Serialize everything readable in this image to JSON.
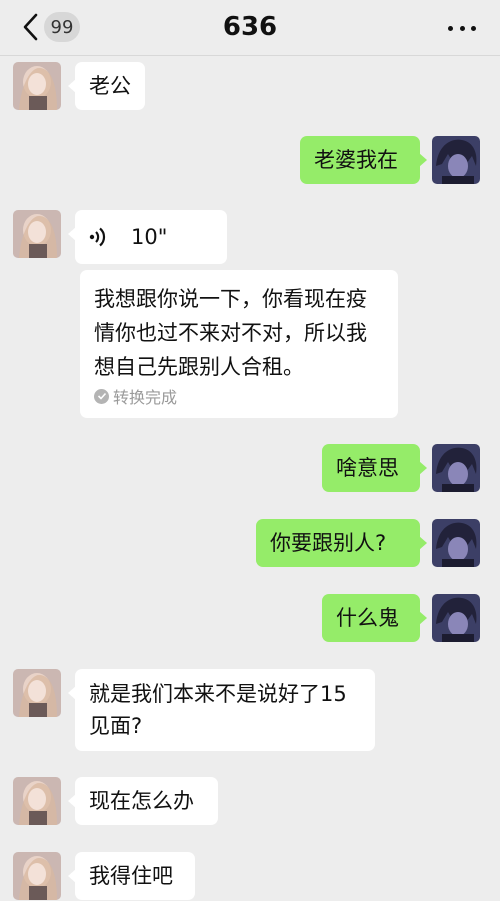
{
  "header": {
    "title": "636",
    "unread_badge": "99",
    "icons": {
      "back": "chevron-left-icon",
      "more": "more-dots-icon"
    }
  },
  "messages": [
    {
      "side": "in",
      "text": "老公"
    },
    {
      "side": "out",
      "text": "老婆我在"
    },
    {
      "side": "in",
      "type": "voice",
      "duration": "10\"",
      "transcript": "我想跟你说一下，你看现在疫情你也过不来对不对，所以我想自己先跟别人合租。",
      "transcript_status": "转换完成"
    },
    {
      "side": "out",
      "text": "啥意思"
    },
    {
      "side": "out",
      "text": "你要跟别人?"
    },
    {
      "side": "out",
      "text": "什么鬼"
    },
    {
      "side": "in",
      "text": "就是我们本来不是说好了15见面?"
    },
    {
      "side": "in",
      "text": "现在怎么办"
    },
    {
      "side": "in",
      "text": "我得住吧"
    }
  ],
  "colors": {
    "background": "#ededed",
    "incoming_bubble": "#ffffff",
    "outgoing_bubble": "#95ec69"
  }
}
